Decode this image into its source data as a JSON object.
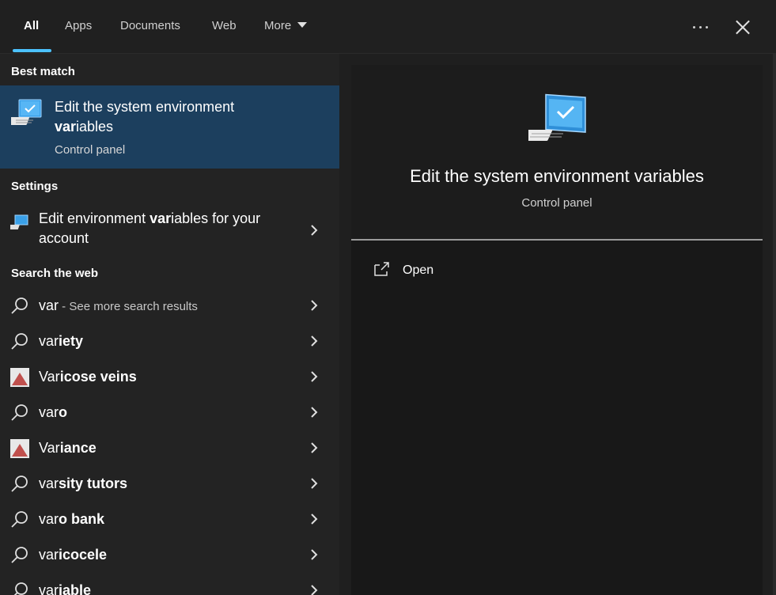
{
  "tabs": [
    {
      "label": "All"
    },
    {
      "label": "Apps"
    },
    {
      "label": "Documents"
    },
    {
      "label": "Web"
    },
    {
      "label": "More"
    }
  ],
  "sections": {
    "best_match": "Best match",
    "settings": "Settings",
    "search_web": "Search the web"
  },
  "best_match": {
    "title_pre": "Edit the system environment ",
    "title_bold": "var",
    "title_post": "iables",
    "subtitle": "Control panel",
    "icon": "computer-monitor-icon"
  },
  "settings_item": {
    "pre": "Edit environment ",
    "bold": "var",
    "post": "iables for your account",
    "icon": "monitor-settings-icon"
  },
  "web_results": [
    {
      "pre": "var",
      "bold": "",
      "sub": " - See more search results",
      "icon": "search-icon"
    },
    {
      "pre": "var",
      "bold": "iety",
      "sub": "",
      "icon": "search-icon"
    },
    {
      "pre": "Var",
      "bold": "icose veins",
      "sub": "",
      "icon": "image-thumbnail-icon"
    },
    {
      "pre": "var",
      "bold": "o",
      "sub": "",
      "icon": "search-icon"
    },
    {
      "pre": "Var",
      "bold": "iance",
      "sub": "",
      "icon": "image-thumbnail-icon"
    },
    {
      "pre": "var",
      "bold": "sity tutors",
      "sub": "",
      "icon": "search-icon"
    },
    {
      "pre": "var",
      "bold": "o bank",
      "sub": "",
      "icon": "search-icon"
    },
    {
      "pre": "var",
      "bold": "icocele",
      "sub": "",
      "icon": "search-icon"
    },
    {
      "pre": "var",
      "bold": "iable",
      "sub": "",
      "icon": "search-icon"
    }
  ],
  "preview": {
    "title": "Edit the system environment variables",
    "subtitle": "Control panel",
    "action_open": "Open"
  },
  "colors": {
    "accent": "#4cc2ff",
    "selected_bg": "#1c3f5e"
  }
}
